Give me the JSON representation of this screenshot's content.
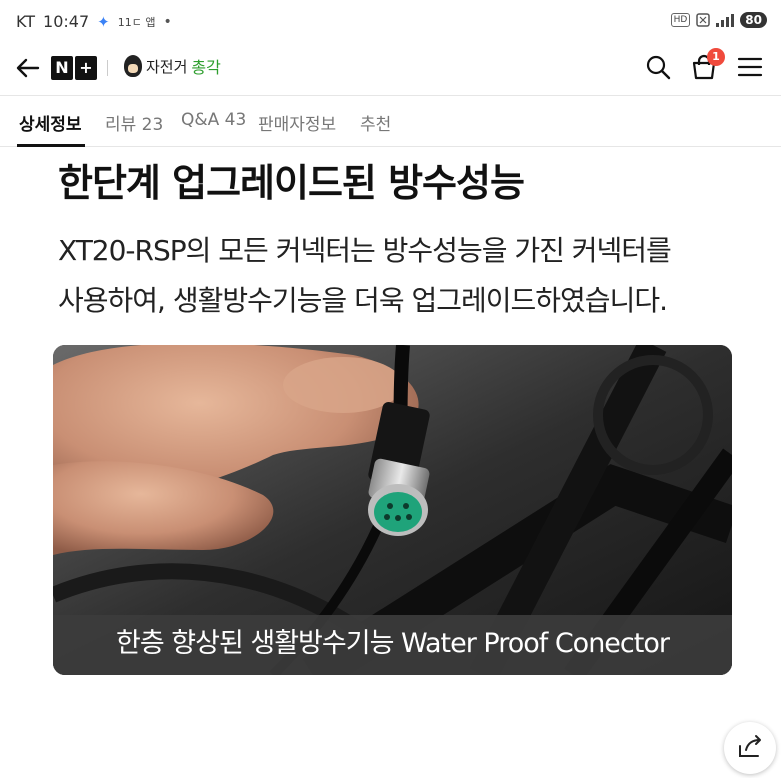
{
  "status_bar": {
    "carrier": "KT",
    "time": "10:47",
    "mini_label": "11ㄷ 앱",
    "dot": "•",
    "hd_label": "HD",
    "battery": "80"
  },
  "header": {
    "logo_letters": [
      "N",
      "+"
    ],
    "brand_text": "자전거",
    "brand_accent": "총각",
    "cart_count": "1"
  },
  "tabs": [
    {
      "label": "상세정보",
      "active": true
    },
    {
      "label": "리뷰 23",
      "active": false
    },
    {
      "label": "Q&A 43",
      "active": false
    },
    {
      "label": "판매자정보",
      "active": false
    },
    {
      "label": "추천",
      "active": false
    }
  ],
  "content": {
    "title": "한단계 업그레이드된 방수성능",
    "desc_line1": "XT20-RSP의 모든 커넥터는 방수성능을 가진 커넥터를",
    "desc_line2": "사용하여, 생활방수기능을 더욱 업그레이드하였습니다.",
    "caption": "한층 향상된 생활방수기능 Water Proof Conector"
  },
  "colors": {
    "accent_green": "#2e9e2e",
    "badge_red": "#f04a3c",
    "connector_green": "#1fa37a"
  },
  "icons": {
    "back": "arrow-left-icon",
    "search": "search-icon",
    "cart": "shopping-bag-icon",
    "menu": "hamburger-menu-icon",
    "share": "share-icon"
  }
}
